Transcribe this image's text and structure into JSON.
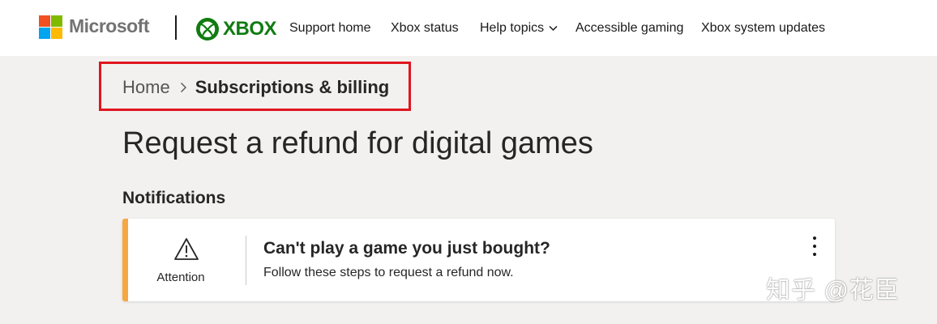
{
  "header": {
    "ms_brand": "Microsoft",
    "xbox_brand": "XBOX",
    "nav": [
      {
        "label": "Support home"
      },
      {
        "label": "Xbox status"
      },
      {
        "label": "Help topics"
      },
      {
        "label": "Accessible gaming"
      },
      {
        "label": "Xbox system updates"
      }
    ]
  },
  "breadcrumb": {
    "home": "Home",
    "current": "Subscriptions & billing"
  },
  "page": {
    "title": "Request a refund for digital games",
    "section_title": "Notifications"
  },
  "notification": {
    "icon": "warning-triangle-icon",
    "badge_label": "Attention",
    "title": "Can't play a game you just bought?",
    "description": "Follow these steps to request a refund now.",
    "accent_color": "#f5a742"
  },
  "watermark": {
    "text": "知乎 @花臣"
  },
  "colors": {
    "ms_red": "#f25022",
    "ms_green": "#7fba00",
    "ms_blue": "#00a4ef",
    "ms_yellow": "#ffb900",
    "xbox_green": "#107c10",
    "highlight_box": "#e0151f"
  }
}
